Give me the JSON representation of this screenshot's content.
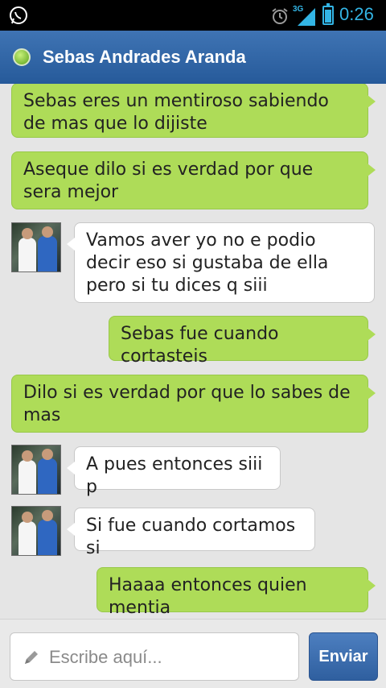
{
  "status_bar": {
    "time": "0:26",
    "network": "3G",
    "icons": [
      "whatsapp-icon",
      "alarm-icon",
      "signal-icon",
      "battery-icon"
    ],
    "accent_color": "#33b5e5"
  },
  "header": {
    "contact_name": "Sebas Andrades Aranda",
    "status_color": "#5aa31a"
  },
  "messages": [
    {
      "direction": "out",
      "text": "Sebas eres un mentiroso sabiendo de mas que lo dijiste"
    },
    {
      "direction": "out",
      "text": "Aseque dilo si es verdad por que sera mejor"
    },
    {
      "direction": "in",
      "text": "Vamos aver yo no e podio decir eso si gustaba de ella pero si tu dices q siii"
    },
    {
      "direction": "out",
      "text": "Sebas fue cuando cortasteis"
    },
    {
      "direction": "out",
      "text": "Dilo si es verdad por que lo sabes de mas"
    },
    {
      "direction": "in",
      "text": "A pues entonces siii p"
    },
    {
      "direction": "in",
      "text": "Si fue cuando cortamos si"
    },
    {
      "direction": "out",
      "text": "Haaaa entonces quien mentia"
    }
  ],
  "composer": {
    "placeholder": "Escribe aquí...",
    "send_label": "Enviar"
  },
  "colors": {
    "outgoing_bubble": "#aedc58",
    "incoming_bubble": "#ffffff",
    "header": "#3168a8"
  }
}
